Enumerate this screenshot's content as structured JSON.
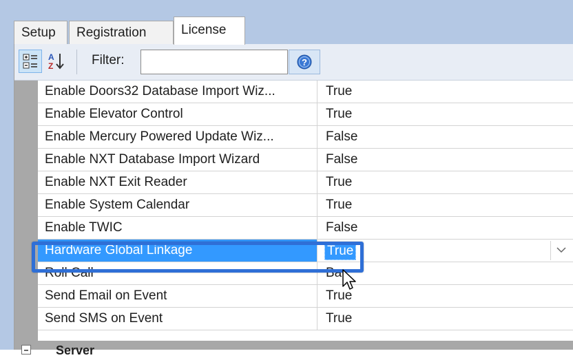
{
  "tabs": [
    {
      "label": "Setup"
    },
    {
      "label": "Registration"
    },
    {
      "label": "License",
      "active": true
    }
  ],
  "toolbar": {
    "categorized_icon": "categorized-view-icon",
    "alphabetical_icon": "sort-alphabetical-icon",
    "filter_label": "Filter:",
    "filter_value": "",
    "help_icon": "help-icon"
  },
  "properties": [
    {
      "name": "Enable Doors32 Database Import Wiz...",
      "value": "True"
    },
    {
      "name": "Enable Elevator Control",
      "value": "True"
    },
    {
      "name": "Enable Mercury Powered Update Wiz...",
      "value": "False"
    },
    {
      "name": "Enable NXT Database Import Wizard",
      "value": "False"
    },
    {
      "name": "Enable NXT Exit Reader",
      "value": "True"
    },
    {
      "name": "Enable System Calendar",
      "value": "True"
    },
    {
      "name": "Enable TWIC",
      "value": "False"
    },
    {
      "name": "Hardware Global Linkage",
      "value": "True",
      "selected": true
    },
    {
      "name": "Roll Call",
      "value": "Ba"
    },
    {
      "name": "Send Email on Event",
      "value": "True"
    },
    {
      "name": "Send SMS on Event",
      "value": "True"
    }
  ],
  "next_category": {
    "label": "Server",
    "state": "expanded"
  },
  "colors": {
    "selection": "#3399ff",
    "highlight_border": "#2f6fd6",
    "background": "#b4c8e4"
  }
}
